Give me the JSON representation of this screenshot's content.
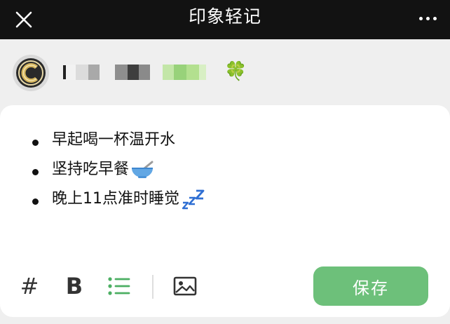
{
  "header": {
    "title": "印象轻记",
    "close_icon": "close-icon",
    "more_icon": "more-horizontal-icon"
  },
  "account": {
    "avatar_icon": "logo-c-avatar",
    "name": "[redacted]",
    "name_suffix_emoji": "🍀"
  },
  "note": {
    "items": [
      {
        "text": "早起喝一杯温开水"
      },
      {
        "text": "坚持吃早餐",
        "icon": "bowl-spoon-icon"
      },
      {
        "text": "晚上11点准时睡觉",
        "icon": "zzz-icon"
      }
    ]
  },
  "toolbar": {
    "tag_label": "#",
    "bold_label": "B",
    "list_icon": "bulleted-list-icon",
    "image_icon": "image-icon",
    "save_label": "保存"
  },
  "colors": {
    "titlebar": "#121212",
    "background": "#efefef",
    "accent_green": "#6dc07a",
    "list_icon_green": "#4caf63"
  }
}
